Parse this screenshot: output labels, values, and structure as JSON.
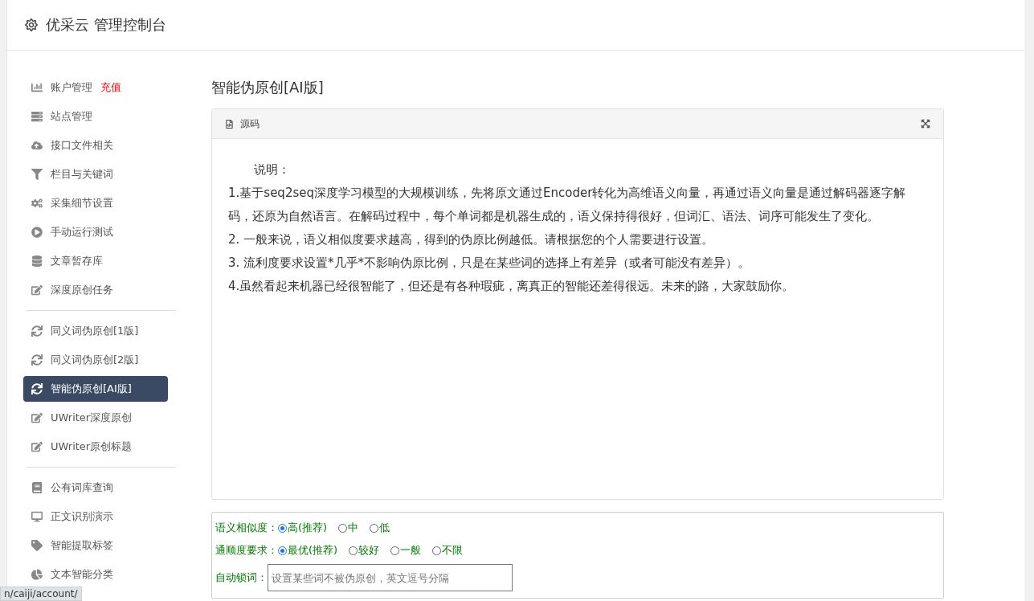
{
  "header": {
    "title": "优采云 管理控制台"
  },
  "sidebar": {
    "groups": [
      {
        "items": [
          {
            "label": "账户管理",
            "badge": "充值",
            "selected": false
          },
          {
            "label": "站点管理",
            "selected": false
          },
          {
            "label": "接口文件相关",
            "selected": false
          },
          {
            "label": "栏目与关键词",
            "selected": false
          },
          {
            "label": "采集细节设置",
            "selected": false
          },
          {
            "label": "手动运行测试",
            "selected": false
          },
          {
            "label": "文章暂存库",
            "selected": false
          },
          {
            "label": "深度原创任务",
            "selected": false
          }
        ]
      },
      {
        "items": [
          {
            "label": "同义词伪原创[1版]",
            "selected": false
          },
          {
            "label": "同义词伪原创[2版]",
            "selected": false
          },
          {
            "label": "智能伪原创[AI版]",
            "selected": true
          },
          {
            "label": "UWriter深度原创",
            "selected": false
          },
          {
            "label": "UWriter原创标题",
            "selected": false
          }
        ]
      },
      {
        "items": [
          {
            "label": "公有词库查询",
            "selected": false
          },
          {
            "label": "正文识别演示",
            "selected": false
          },
          {
            "label": "智能提取标签",
            "selected": false
          },
          {
            "label": "文本智能分类",
            "selected": false
          }
        ]
      }
    ]
  },
  "main": {
    "title": "智能伪原创[AI版]",
    "source_panel": {
      "title": "源码",
      "lines": [
        "说明：",
        "1.基于seq2seq深度学习模型的大规模训练，先将原文通过Encoder转化为高维语义向量，再通过语义向量是通过解码器逐字解码，还原为自然语言。在解码过程中，每个单词都是机器生成的，语义保持得很好，但词汇、语法、词序可能发生了变化。",
        "2. 一般来说，语义相似度要求越高，得到的伪原比例越低。请根据您的个人需要进行设置。",
        "3. 流利度要求设置*几乎*不影响伪原比例，只是在某些词的选择上有差异（或者可能没有差异）。",
        "4.虽然看起来机器已经很智能了，但还是有各种瑕疵，离真正的智能还差得很远。未来的路，大家鼓励你。"
      ]
    },
    "options": [
      {
        "kind": "radio",
        "label": "语义相似度：",
        "choices": [
          {
            "label": "高(推荐)",
            "selected": true
          },
          {
            "label": "中",
            "selected": false
          },
          {
            "label": "低",
            "selected": false
          }
        ]
      },
      {
        "kind": "radio",
        "label": "通顺度要求：",
        "choices": [
          {
            "label": "最优(推荐)",
            "selected": true
          },
          {
            "label": "较好",
            "selected": false
          },
          {
            "label": "一般",
            "selected": false
          },
          {
            "label": "不限",
            "selected": false
          }
        ]
      },
      {
        "kind": "text",
        "label": "自动锁词：",
        "placeholder": "设置某些词不被伪原创，英文逗号分隔"
      }
    ]
  },
  "status_bar": {
    "url": "n/caiji/account/"
  }
}
